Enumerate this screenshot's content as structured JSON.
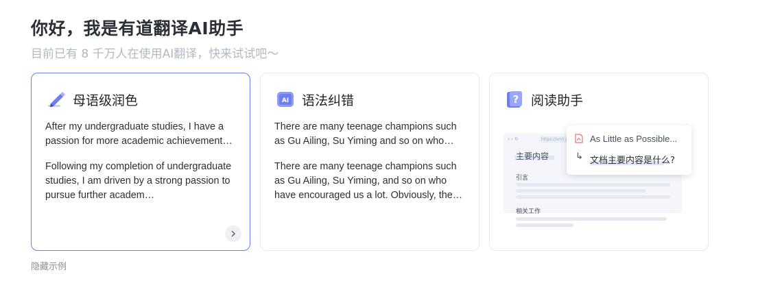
{
  "header": {
    "title": "你好，我是有道翻译AI助手",
    "subtitle": "目前已有 8 千万人在使用AI翻译，快来试试吧～"
  },
  "cards": [
    {
      "title": "母语级润色",
      "icon": "pen-icon",
      "example_input": "After my undergraduate studies, I have a passion for more academic achievement…",
      "example_output": "Following my completion of undergraduate studies, I am driven by a strong passion to pursue further academ…"
    },
    {
      "title": "语法纠错",
      "icon": "ai-badge-icon",
      "example_input": "There are many teenage champions such as Gu Ailing, Su Yiming and so on who…",
      "example_output": "There are many teenage champions such as Gu Ailing, Su Yiming, and so on who have encouraged us a lot. Obviously, the…"
    },
    {
      "title": "阅读助手",
      "icon": "question-book-icon",
      "preview": {
        "doc_heading": "主要内容",
        "section_1": "引言",
        "section_2": "相关工作",
        "url_text": "https://smt.y...",
        "file_name": "As Little as Possible...",
        "question": "文档主要内容是什么?"
      }
    }
  ],
  "hide_examples_label": "隐藏示例",
  "colors": {
    "active_border": "#6b7ff0",
    "title": "#2b2f36",
    "subtitle": "#b3b8c2"
  }
}
